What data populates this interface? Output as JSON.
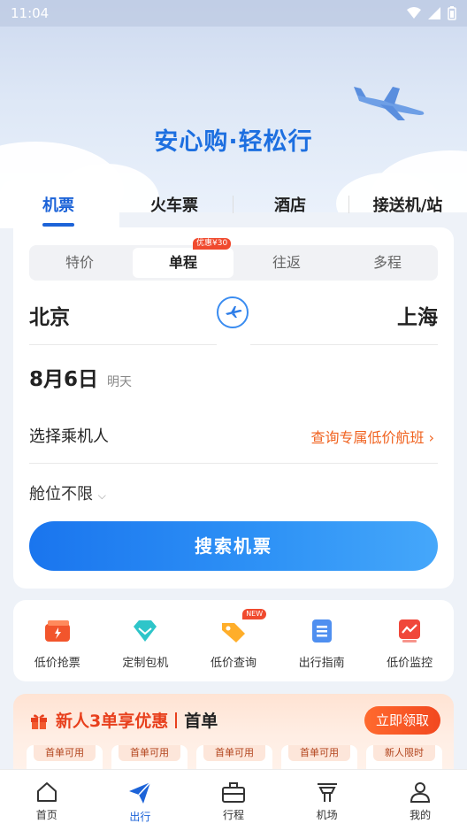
{
  "status_bar": {
    "time": "11:04"
  },
  "hero": {
    "slogan": "安心购·轻松行"
  },
  "tabs": [
    {
      "label": "机票"
    },
    {
      "label": "火车票"
    },
    {
      "label": "酒店"
    },
    {
      "label": "接送机/站"
    }
  ],
  "trip_types": {
    "items": [
      "特价",
      "单程",
      "往返",
      "多程"
    ],
    "selected": "单程",
    "badge": "优惠¥30"
  },
  "route": {
    "from": "北京",
    "to": "上海"
  },
  "date": {
    "main": "8月6日",
    "sub": "明天"
  },
  "passenger": {
    "label": "选择乘机人",
    "low_price_link": "查询专属低价航班"
  },
  "cabin": {
    "label": "舱位不限"
  },
  "search": {
    "button_label": "搜索机票"
  },
  "tools": [
    {
      "label": "低价抢票",
      "icon": "ticket-icon"
    },
    {
      "label": "定制包机",
      "icon": "diamond-icon"
    },
    {
      "label": "低价查询",
      "icon": "price-tag-icon",
      "badge": "NEW"
    },
    {
      "label": "出行指南",
      "icon": "guide-icon"
    },
    {
      "label": "低价监控",
      "icon": "monitor-icon"
    }
  ],
  "promo": {
    "title": "新人3单享优惠",
    "first": "首单",
    "claim_label": "立即领取",
    "coupons": [
      "首单可用",
      "首单可用",
      "首单可用",
      "首单可用",
      "新人限时"
    ]
  },
  "bottom_nav": [
    {
      "label": "首页",
      "icon": "home-icon"
    },
    {
      "label": "出行",
      "icon": "paper-plane-icon",
      "active": true
    },
    {
      "label": "行程",
      "icon": "luggage-icon"
    },
    {
      "label": "机场",
      "icon": "airport-icon"
    },
    {
      "label": "我的",
      "icon": "user-icon"
    }
  ],
  "colors": {
    "accent": "#1c63d8",
    "orange": "#f0621f",
    "red": "#e8401d"
  }
}
